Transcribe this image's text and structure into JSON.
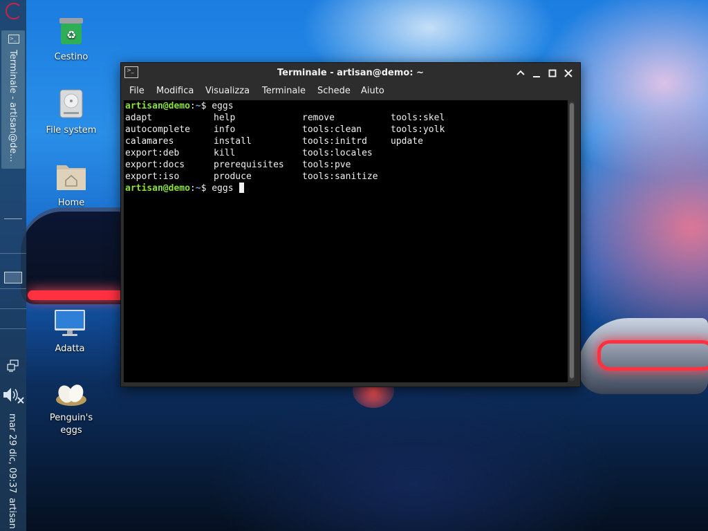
{
  "desktop": {
    "icons": [
      {
        "label": "Cestino",
        "icon": "trash-icon"
      },
      {
        "label": "File system",
        "icon": "drive-icon"
      },
      {
        "label": "Home",
        "icon": "home-folder-icon"
      },
      {
        "label": "Adatta",
        "icon": "monitor-icon"
      },
      {
        "label": "Penguin's",
        "label2": "eggs",
        "icon": "eggs-icon"
      }
    ]
  },
  "panel": {
    "task_label": "Terminale - artisan@de...",
    "clock": "mar 29 dic, 09:37",
    "user": "artisan"
  },
  "window": {
    "title": "Terminale - artisan@demo: ~",
    "menu": [
      "File",
      "Modifica",
      "Visualizza",
      "Terminale",
      "Schede",
      "Aiuto"
    ]
  },
  "terminal": {
    "prompt_user": "artisan@demo",
    "prompt_sep": ":",
    "prompt_path": "~",
    "prompt_dollar": "$ ",
    "command1": "eggs",
    "command2": "eggs ",
    "columns": [
      [
        "adapt",
        "autocomplete",
        "calamares",
        "export:deb",
        "export:docs",
        "export:iso"
      ],
      [
        "help",
        "info",
        "install",
        "kill",
        "prerequisites",
        "produce"
      ],
      [
        "remove",
        "tools:clean",
        "tools:initrd",
        "tools:locales",
        "tools:pve",
        "tools:sanitize"
      ],
      [
        "tools:skel",
        "tools:yolk",
        "update"
      ]
    ]
  },
  "colors": {
    "prompt_user": "#8ae234",
    "prompt_path": "#729fcf",
    "terminal_bg": "#000000",
    "window_bg": "#2d2d2d"
  }
}
